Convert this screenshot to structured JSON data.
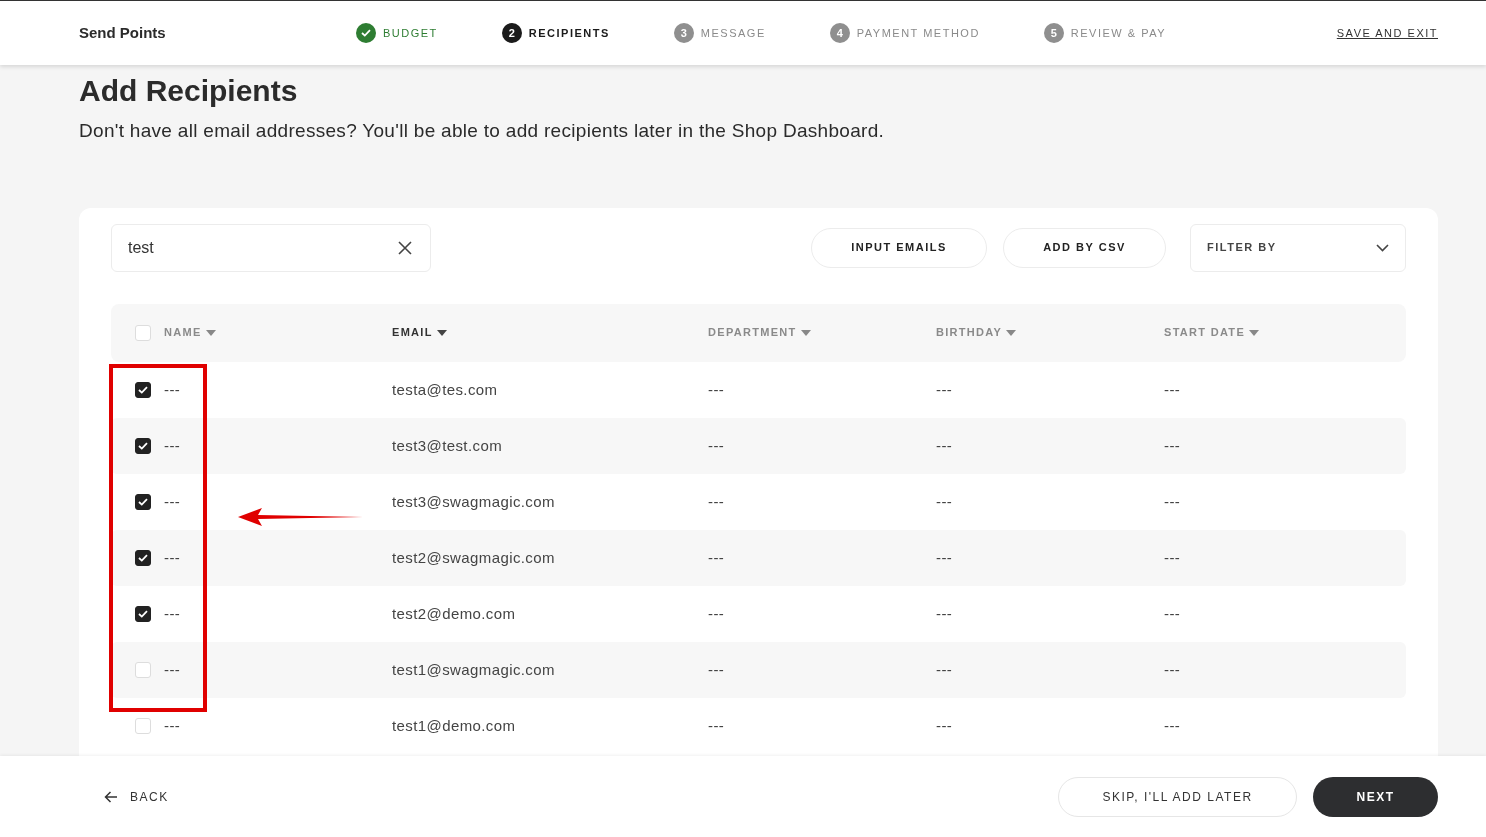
{
  "header": {
    "title": "Send Points",
    "save_link": "SAVE AND EXIT"
  },
  "steps": [
    {
      "label": "BUDGET",
      "completed": true,
      "selected": false
    },
    {
      "number": "2",
      "label": "RECIPIENTS",
      "completed": false,
      "selected": true
    },
    {
      "number": "3",
      "label": "MESSAGE",
      "completed": false,
      "selected": false
    },
    {
      "number": "4",
      "label": "PAYMENT METHOD",
      "completed": false,
      "selected": false
    },
    {
      "number": "5",
      "label": "REVIEW & PAY",
      "completed": false,
      "selected": false
    }
  ],
  "page": {
    "title": "Add Recipients",
    "subtitle": "Don't have all email addresses? You'll be able to add recipients later in the Shop Dashboard."
  },
  "search": {
    "value": "test"
  },
  "actions": [
    "INPUT EMAILS",
    "ADD BY CSV"
  ],
  "filter": {
    "placeholder": "FILTER BY"
  },
  "table": {
    "select_all": {
      "checked": false
    },
    "columns": [
      {
        "label": "NAME",
        "selected": false
      },
      {
        "label": "EMAIL",
        "selected": true
      },
      {
        "label": "DEPARTMENT",
        "selected": false
      },
      {
        "label": "BIRTHDAY",
        "selected": false
      },
      {
        "label": "START DATE",
        "selected": false
      }
    ],
    "rows": [
      {
        "checked": true,
        "cells": [
          "---",
          "testa@tes.com",
          "---",
          "---",
          "---"
        ]
      },
      {
        "checked": true,
        "cells": [
          "---",
          "test3@test.com",
          "---",
          "---",
          "---"
        ]
      },
      {
        "checked": true,
        "cells": [
          "---",
          "test3@swagmagic.com",
          "---",
          "---",
          "---"
        ]
      },
      {
        "checked": true,
        "cells": [
          "---",
          "test2@swagmagic.com",
          "---",
          "---",
          "---"
        ]
      },
      {
        "checked": true,
        "cells": [
          "---",
          "test2@demo.com",
          "---",
          "---",
          "---"
        ]
      },
      {
        "checked": false,
        "cells": [
          "---",
          "test1@swagmagic.com",
          "---",
          "---",
          "---"
        ]
      },
      {
        "checked": false,
        "cells": [
          "---",
          "test1@demo.com",
          "---",
          "---",
          "---"
        ]
      }
    ]
  },
  "footer": {
    "back": "BACK",
    "skip": "SKIP, I'LL ADD LATER",
    "next": "NEXT"
  }
}
